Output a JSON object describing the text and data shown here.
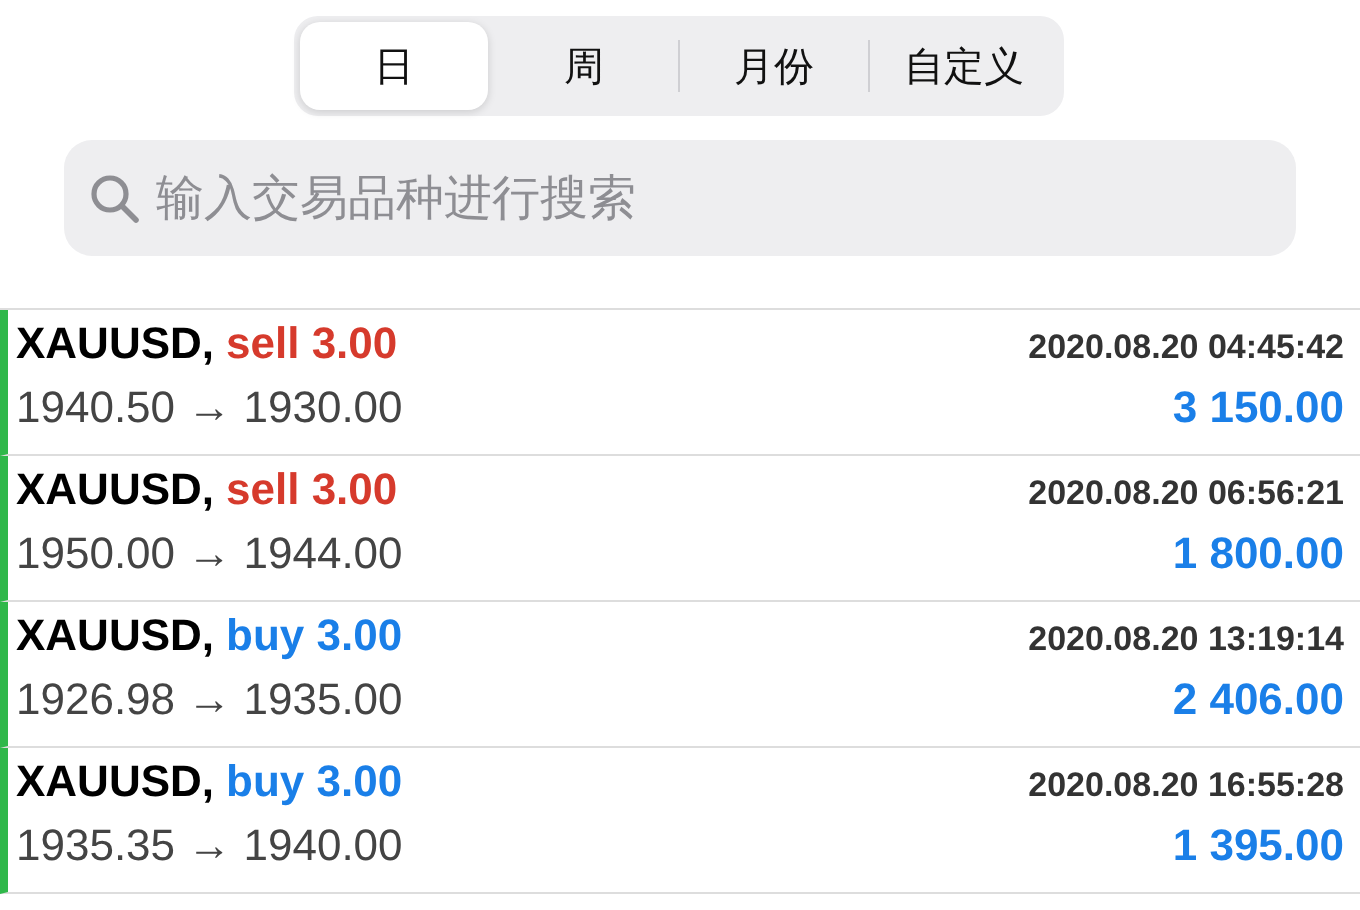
{
  "period_tabs": [
    {
      "label": "日",
      "selected": true
    },
    {
      "label": "周",
      "selected": false
    },
    {
      "label": "月份",
      "selected": false
    },
    {
      "label": "自定义",
      "selected": false
    }
  ],
  "search": {
    "placeholder": "输入交易品种进行搜索"
  },
  "trades": [
    {
      "symbol": "XAUUSD,",
      "kind": "sell",
      "order": "sell 3.00",
      "time": "2020.08.20 04:45:42",
      "prices": "1940.50 → 1930.00",
      "profit": "3 150.00"
    },
    {
      "symbol": "XAUUSD,",
      "kind": "sell",
      "order": "sell 3.00",
      "time": "2020.08.20 06:56:21",
      "prices": "1950.00 → 1944.00",
      "profit": "1 800.00"
    },
    {
      "symbol": "XAUUSD,",
      "kind": "buy",
      "order": "buy 3.00",
      "time": "2020.08.20 13:19:14",
      "prices": "1926.98 → 1935.00",
      "profit": "2 406.00"
    },
    {
      "symbol": "XAUUSD,",
      "kind": "buy",
      "order": "buy 3.00",
      "time": "2020.08.20 16:55:28",
      "prices": "1935.35 → 1940.00",
      "profit": "1 395.00"
    }
  ]
}
